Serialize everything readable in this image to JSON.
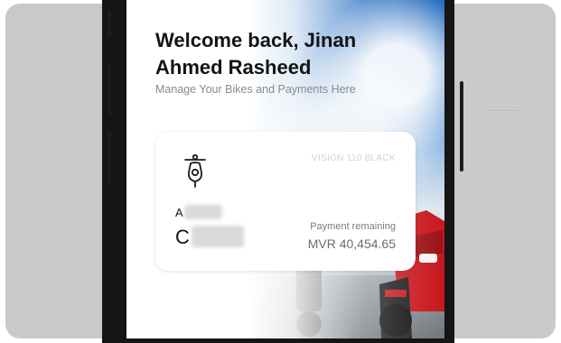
{
  "header": {
    "welcome_text": "Welcome back, Jinan Ahmed Rasheed",
    "subtitle": "Manage Your Bikes and Payments Here"
  },
  "bike_card": {
    "icon": "scooter-icon",
    "model": "VISION 110 BLACK",
    "owner_line_1_visible": "A",
    "owner_line_2_visible": "C",
    "payment_label": "Payment remaining",
    "payment_amount": "MVR 40,454.65"
  },
  "colors": {
    "sky_blue": "#2a6fc2",
    "bike_red": "#c8161d",
    "text_dark": "#141414",
    "text_muted": "#8a8a8a"
  }
}
